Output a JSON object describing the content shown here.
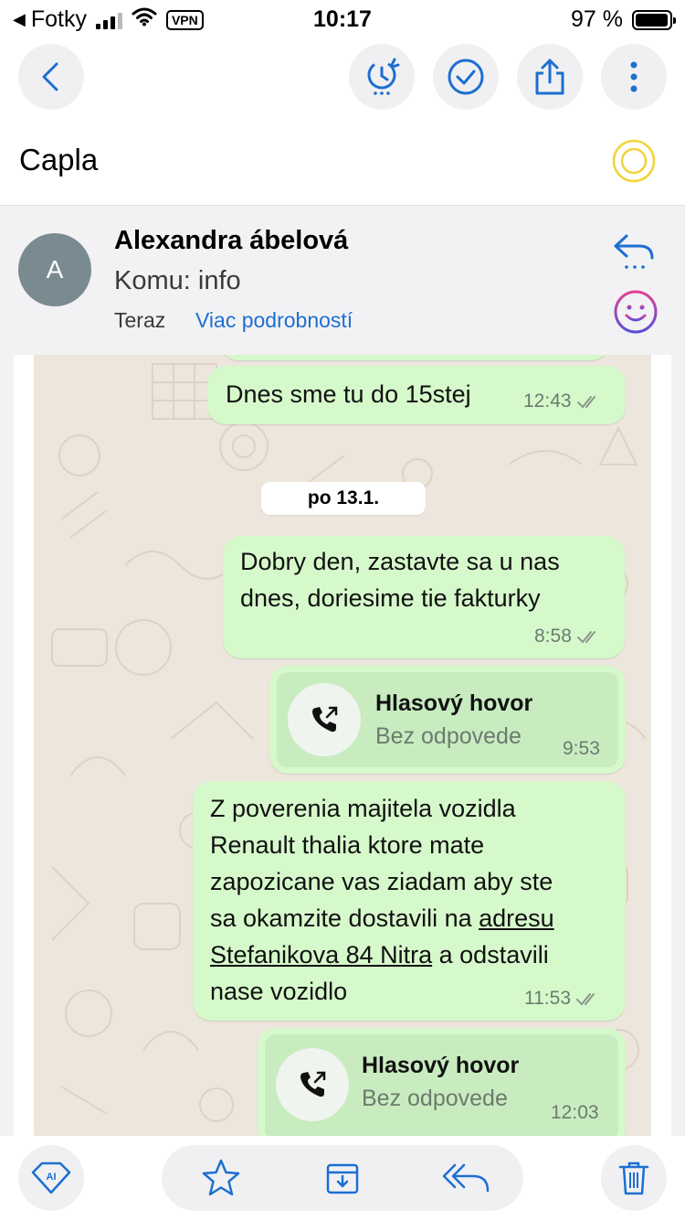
{
  "status_bar": {
    "back_app": "Fotky",
    "vpn": "VPN",
    "time": "10:17",
    "battery": "97 %",
    "battery_level_percent": 97
  },
  "toolbar": {
    "icons": [
      "back-chevron-icon",
      "snooze-clock-icon",
      "done-check-icon",
      "share-icon",
      "more-icon"
    ]
  },
  "email": {
    "subject": "Capla",
    "avatar_initial": "A",
    "sender": "Alexandra ábelová",
    "to": "Komu: info",
    "time": "Teraz",
    "details_link": "Viac podrobností"
  },
  "chat": {
    "messages": [
      {
        "text": "Dnes sme tu do 15stej",
        "time": "12:43"
      },
      {
        "date": "po 13.1."
      },
      {
        "text_lines": [
          "Dobry den, zastavte sa u nas",
          "dnes, doriesime tie fakturky"
        ],
        "time": "8:58"
      },
      {
        "call_title": "Hlasový hovor",
        "call_status": "Bez odpovede",
        "time": "9:53"
      },
      {
        "line1": "Z poverenia majitela vozidla",
        "line2": "Renault thalia ktore mate",
        "line3": "zapozicane vas ziadam aby ste",
        "line4_pre": "sa okamzite dostavili na ",
        "line4_link": "adresu",
        "line5_link": "Stefanikova 84 Nitra",
        "line5_post": " a odstavili",
        "line6": "nase vozidlo",
        "time": "11:53"
      },
      {
        "call_title": "Hlasový hovor",
        "call_status": "Bez odpovede",
        "time": "12:03"
      }
    ]
  },
  "bottom_bar": {
    "ai_badge": "AI",
    "icons": [
      "ai-assistant-icon",
      "star-icon",
      "archive-icon",
      "reply-all-icon",
      "trash-icon"
    ]
  },
  "colors": {
    "accent": "#1d6fd1",
    "bubble_green": "#d6f9cb",
    "call_card": "#c8ecc0",
    "chat_background": "#ede6dc",
    "avatar": "#7a8a91",
    "subject_ring": "#f3d33a"
  }
}
